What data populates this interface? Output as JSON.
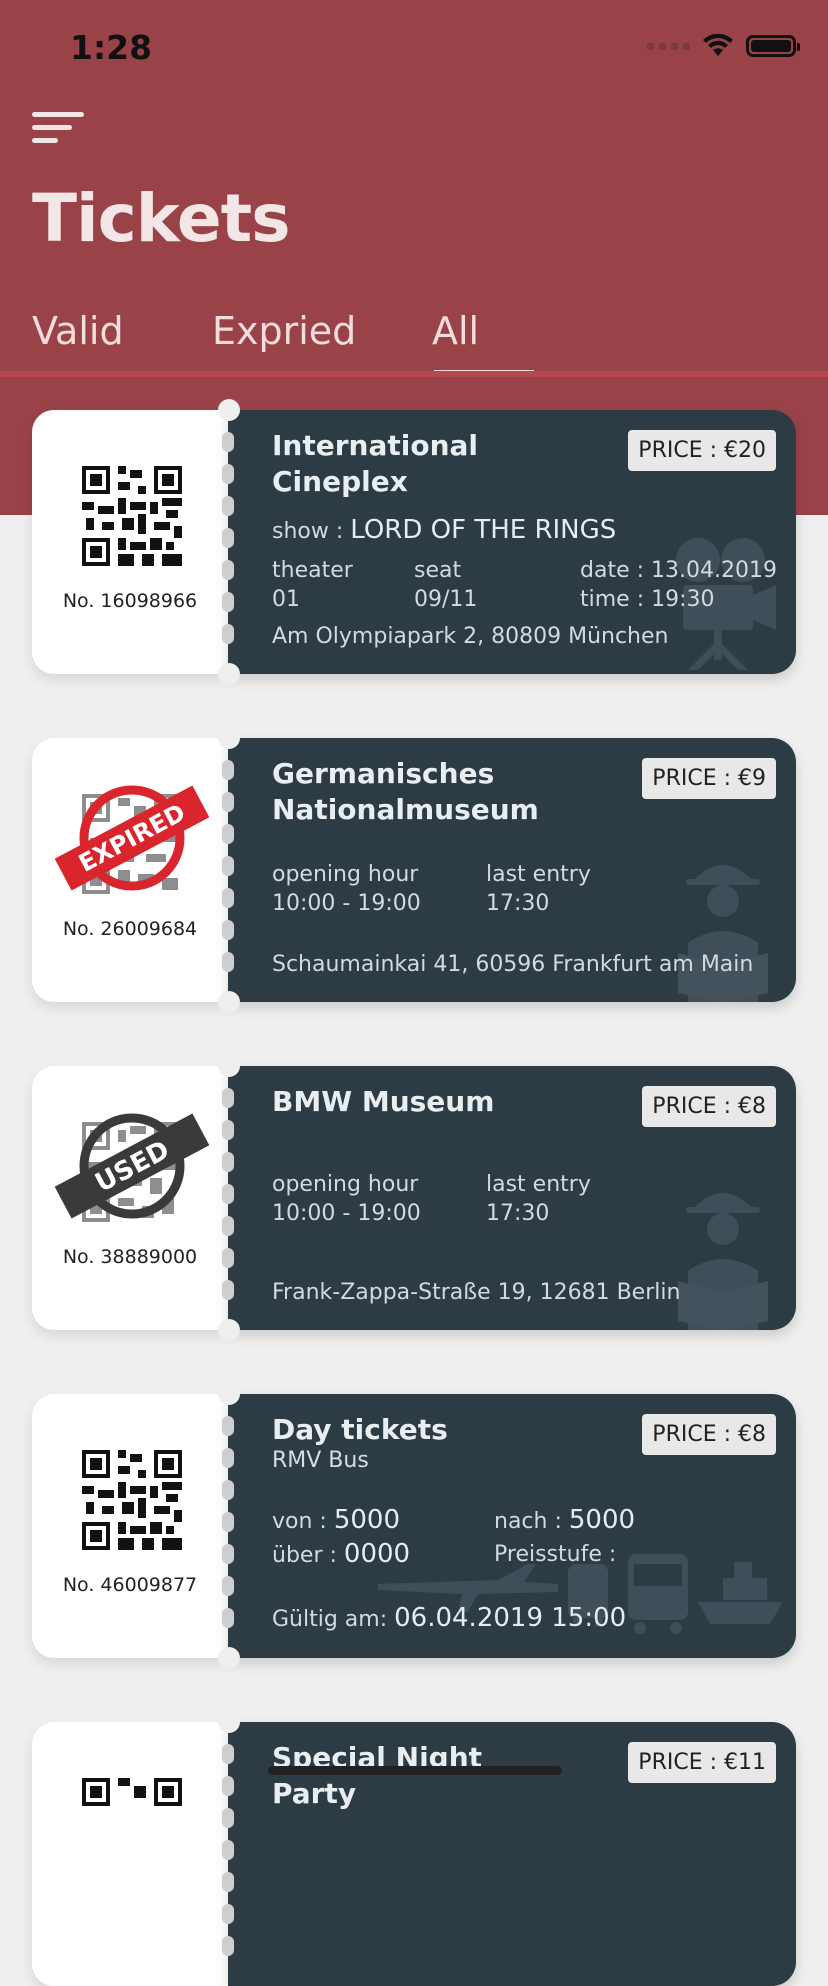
{
  "status": {
    "time": "1:28"
  },
  "header": {
    "title": "Tickets"
  },
  "tabs": [
    {
      "label": "Valid"
    },
    {
      "label": "Expried"
    },
    {
      "label": "All"
    }
  ],
  "tickets": [
    {
      "number": "No. 16098966",
      "title_line1": "International",
      "title_line2": "Cineplex",
      "price": "PRICE : €20",
      "show_label": "show :",
      "show_value": "LORD OF THE RINGS",
      "theater_label": "theater",
      "theater_value": "01",
      "seat_label": "seat",
      "seat_value": "09/11",
      "date": "date : 13.04.2019",
      "time": "time : 19:30",
      "address": "Am Olympiapark 2, 80809 München"
    },
    {
      "number": "No. 26009684",
      "stamp": "EXPIRED",
      "title_line1": "Germanisches",
      "title_line2": "Nationalmuseum",
      "price": "PRICE : €9",
      "opening_label": "opening hour",
      "opening_value": "10:00 - 19:00",
      "last_label": "last entry",
      "last_value": "17:30",
      "address": "Schaumainkai 41, 60596 Frankfurt am Main"
    },
    {
      "number": "No. 38889000",
      "stamp": "USED",
      "title_line1": "BMW Museum",
      "price": "PRICE : €8",
      "opening_label": "opening hour",
      "opening_value": "10:00 - 19:00",
      "last_label": "last entry",
      "last_value": "17:30",
      "address": "Frank-Zappa-Straße 19, 12681 Berlin"
    },
    {
      "number": "No. 46009877",
      "title_line1": "Day tickets",
      "subtitle": "RMV Bus",
      "price": "PRICE : €8",
      "von_label": "von :",
      "von_value": "5000",
      "ueber_label": "über :",
      "ueber_value": "0000",
      "nach_label": "nach :",
      "nach_value": "5000",
      "preisstufe_label": "Preisstufe :",
      "gueltig_label": "Gültig am:",
      "gueltig_value": "06.04.2019 15:00"
    },
    {
      "title_line1": "Special Night Party",
      "price": "PRICE : €11"
    }
  ],
  "colors": {
    "header": "#994349",
    "ticket_body": "#2d3b45",
    "background": "#efefef",
    "expired_stamp": "#d8262c",
    "used_stamp": "#3a3a3a"
  }
}
